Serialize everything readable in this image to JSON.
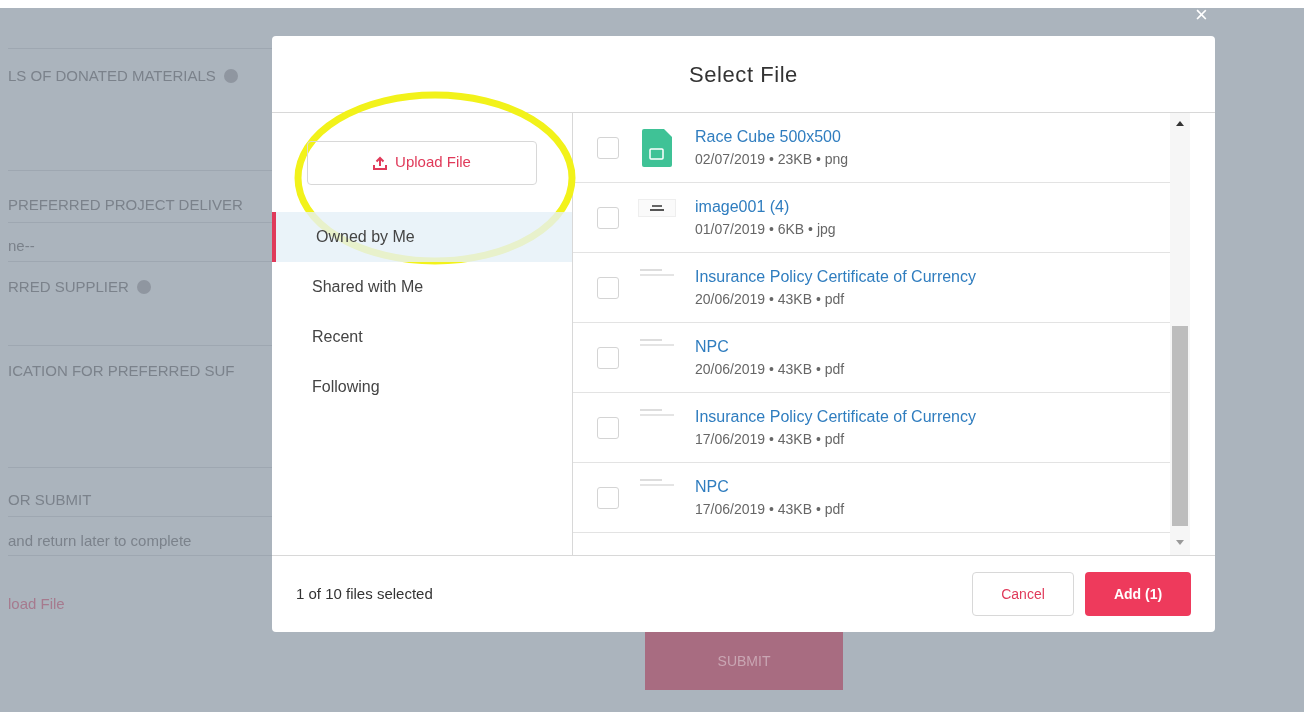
{
  "close": "×",
  "background_form": {
    "rows": [
      {
        "kind": "label",
        "text": "LS OF DONATED MATERIALS",
        "info": true
      },
      {
        "kind": "label",
        "text": "PREFERRED PROJECT DELIVER",
        "info": false
      },
      {
        "kind": "value",
        "text": "ne--"
      },
      {
        "kind": "label",
        "text": "RRED SUPPLIER",
        "info": true
      },
      {
        "kind": "label",
        "text": "ICATION FOR PREFERRED SUF",
        "info": false
      },
      {
        "kind": "label",
        "text": "OR SUBMIT",
        "info": false
      },
      {
        "kind": "value",
        "text": "and return later to complete"
      }
    ],
    "upload_link": "load File",
    "submit": "SUBMIT"
  },
  "dialog": {
    "title": "Select File",
    "upload_button": "Upload File",
    "nav": [
      {
        "label": "Owned by Me",
        "selected": true
      },
      {
        "label": "Shared with Me",
        "selected": false
      },
      {
        "label": "Recent",
        "selected": false
      },
      {
        "label": "Following",
        "selected": false
      }
    ],
    "files": [
      {
        "kind": "image",
        "name": "Race Cube 500x500",
        "meta": "02/07/2019 • 23KB • png",
        "checked": false
      },
      {
        "kind": "thumbnail",
        "name": "image001 (4)",
        "meta": "01/07/2019 • 6KB • jpg",
        "checked": false
      },
      {
        "kind": "document",
        "name": "Insurance Policy Certificate of Currency",
        "meta": "20/06/2019 • 43KB • pdf",
        "checked": false
      },
      {
        "kind": "document",
        "name": "NPC",
        "meta": "20/06/2019 • 43KB • pdf",
        "checked": false
      },
      {
        "kind": "document",
        "name": "Insurance Policy Certificate of Currency",
        "meta": "17/06/2019 • 43KB • pdf",
        "checked": false
      },
      {
        "kind": "document",
        "name": "NPC",
        "meta": "17/06/2019 • 43KB • pdf",
        "checked": false
      }
    ],
    "status": "1 of 10 files selected",
    "cancel": "Cancel",
    "add": "Add (1)"
  }
}
